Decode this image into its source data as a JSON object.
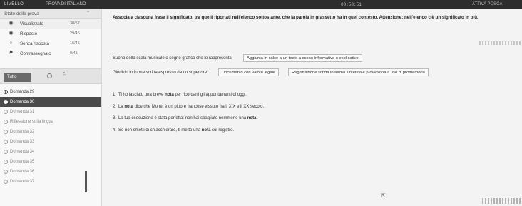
{
  "topbar": {
    "left": "LIVELLO",
    "center": "PROVA DI ITALIANO",
    "timer": "00:58:51",
    "right": "ATTIVA POSCA"
  },
  "sidebar": {
    "status_title": "Stato della prova",
    "stats": [
      {
        "label": "Visualizzato",
        "count": "30/57",
        "icon": "eye-icon"
      },
      {
        "label": "Risposto",
        "count": "29/45",
        "icon": "check-icon"
      },
      {
        "label": "Senza risposta",
        "count": "16/45",
        "icon": "empty-circle-icon"
      },
      {
        "label": "Contrassegnato",
        "count": "0/45",
        "icon": "flag-icon"
      }
    ],
    "filter_all": "Tutto",
    "questions": [
      {
        "label": "Domanda 29",
        "state": "done"
      },
      {
        "label": "Domanda 30",
        "state": "current"
      },
      {
        "label": "Domanda 31",
        "state": "todo"
      },
      {
        "label": "Riflessione sulla lingua",
        "state": "todo"
      },
      {
        "label": "Domanda 32",
        "state": "todo"
      },
      {
        "label": "Domanda 33",
        "state": "todo"
      },
      {
        "label": "Domanda 34",
        "state": "todo"
      },
      {
        "label": "Domanda 35",
        "state": "todo"
      },
      {
        "label": "Domanda 36",
        "state": "todo"
      },
      {
        "label": "Domanda 37",
        "state": "todo"
      }
    ]
  },
  "main": {
    "instruction": "Associa a ciascuna frase il significato, tra quelli riportati nell'elenco sottostante, che la parola in grassetto ha in quel contesto. Attenzione: nell'elenco c'è un significato in più.",
    "definitions": [
      {
        "text": "Suono della scala musicale o segno grafico che lo rappresenta",
        "dropdown": "Aggiunta in calce a un testo a scopo informativo o esplicativo"
      },
      {
        "text": "Giudizio in forma scritta espresso da un superiore",
        "dropdown": "Documento con valore legale"
      },
      {
        "text": "",
        "dropdown": "Registrazione scritta in forma sintetica e provvisoria a uso di promemoria"
      }
    ],
    "sentences": [
      {
        "num": "1.",
        "before": "Ti ho lasciato una breve ",
        "bold": "nota",
        "after": " per ricordarti gli appuntamenti di oggi."
      },
      {
        "num": "2.",
        "before": "La ",
        "bold": "nota",
        "after": " dice che Monet è un pittore francese vissuto fra il XIX e il XX secolo."
      },
      {
        "num": "3.",
        "before": "La tua esecuzione è stata perfetta: non hai sbagliato nemmeno una ",
        "bold": "nota",
        "after": "."
      },
      {
        "num": "4.",
        "before": "Se non smetti di chiacchierare, ti metto una ",
        "bold": "nota",
        "after": " sul registro."
      }
    ]
  }
}
